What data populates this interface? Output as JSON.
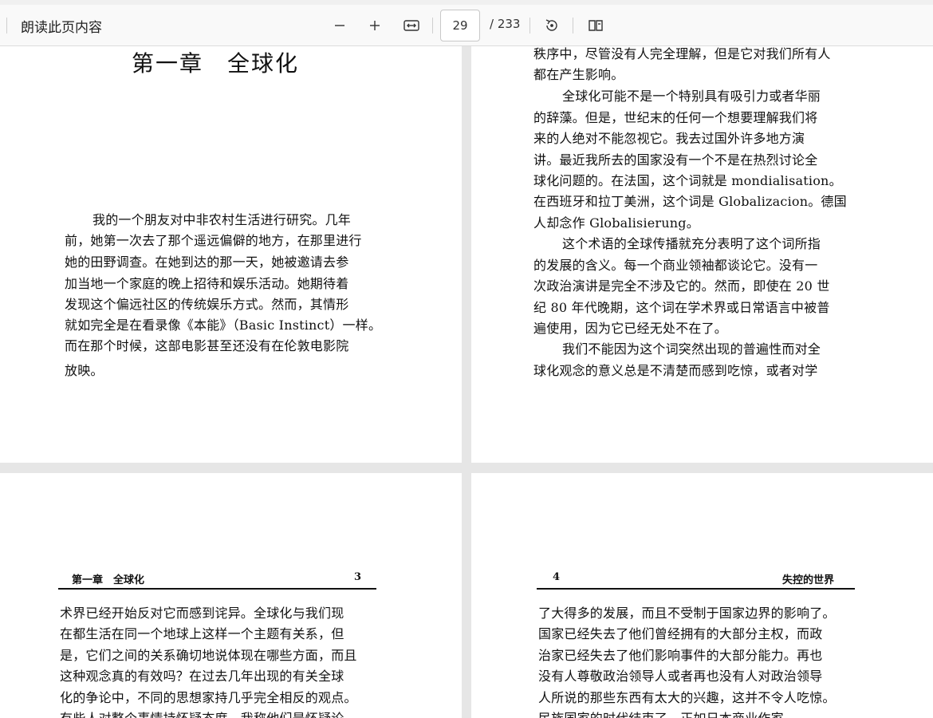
{
  "toolbar": {
    "read_aloud": "朗读此页内容",
    "zoom_out": "zoom-out",
    "zoom_in": "zoom-in",
    "fit_width": "fit-to-width",
    "current_page": "29",
    "total_pages": "/ 233",
    "rotate": "rotate",
    "two_page": "two-page-view"
  },
  "page1": {
    "chapter_title": "第一章　全球化",
    "lines": [
      "我的一个朋友对中非农村生活进行研究。几年",
      "前，她第一次去了那个遥远偏僻的地方，在那里进行",
      "她的田野调查。在她到达的那一天，她被邀请去参",
      "加当地一个家庭的晚上招待和娱乐活动。她期待着",
      "发现这个偏远社区的传统娱乐方式。然而，其情形",
      "就如完全是在看录像《本能》（Basic Instinct）一样。",
      "而在那个时候，这部电影甚至还没有在伦敦电影院",
      "放映。"
    ]
  },
  "page2": {
    "lines": [
      "秩序中，尽管没有人完全理解，但是它对我们所有人",
      "都在产生影响。",
      "全球化可能不是一个特别具有吸引力或者华丽",
      "的辞藻。但是，世纪末的任何一个想要理解我们将",
      "来的人绝对不能忽视它。我去过国外许多地方演",
      "讲。最近我所去的国家没有一个不是在热烈讨论全",
      "球化问题的。在法国，这个词就是 mondialisation。",
      "在西班牙和拉丁美洲，这个词是 Globalizacion。德国",
      "人却念作 Globalisierung。",
      "这个术语的全球传播就充分表明了这个词所指",
      "的发展的含义。每一个商业领袖都谈论它。没有一",
      "次政治演讲是完全不涉及它的。然而，即使在 20 世",
      "纪 80 年代晚期，这个词在学术界或日常语言中被普",
      "遍使用，因为它已经无处不在了。",
      "我们不能因为这个词突然出现的普遍性而对全",
      "球化观念的意义总是不清楚而感到吃惊，或者对学"
    ]
  },
  "page3": {
    "head_left": "第一章　全球化",
    "head_right": "3",
    "lines": [
      "术界已经开始反对它而感到诧异。全球化与我们现",
      "在都生活在同一个地球上这样一个主题有关系，但",
      "是，它们之间的关系确切地说体现在哪些方面，而且",
      "这种观念真的有效吗？在过去几年出现的有关全球",
      "化的争论中，不同的思想家持几乎完全相反的观点。",
      "有些人对整个事情持怀疑态度，我称他们是怀疑论"
    ]
  },
  "page4": {
    "head_left": "4",
    "head_right": "失控的世界",
    "lines": [
      "了大得多的发展，而且不受制于国家边界的影响了。",
      "国家已经失去了他们曾经拥有的大部分主权，而政",
      "治家已经失去了他们影响事件的大部分能力。再也",
      "没有人尊敬政治领导人或者再也没有人对政治领导",
      "人所说的那些东西有太大的兴趣，这并不令人吃惊。",
      "民族国家的时代结束了。正如日本商业作家"
    ]
  }
}
